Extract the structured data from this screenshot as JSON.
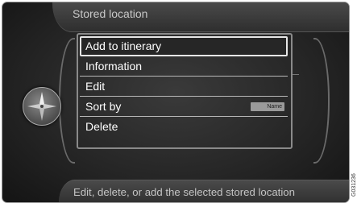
{
  "screen": {
    "title": "Stored location",
    "footer_hint": "Edit, delete, or add the selected stored location"
  },
  "menu": {
    "items": [
      {
        "label": "Add to itinerary",
        "selected": true
      },
      {
        "label": "Information"
      },
      {
        "label": "Edit"
      },
      {
        "label": "Sort by",
        "badge": "Name"
      },
      {
        "label": "Delete"
      }
    ]
  },
  "figure_code": "G031236",
  "icons": {
    "compass": "compass-icon"
  },
  "colors": {
    "background": "#262626",
    "text": "#ffffff",
    "highlight_border": "#e6e6e6"
  }
}
